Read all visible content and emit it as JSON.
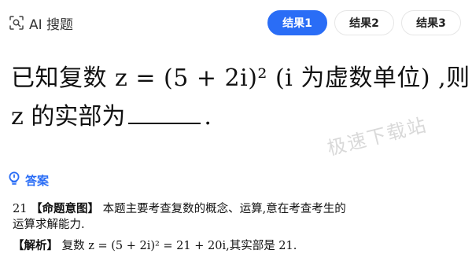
{
  "header": {
    "brand_label": "AI 搜题",
    "tabs": [
      {
        "label": "结果1",
        "active": true
      },
      {
        "label": "结果2",
        "active": false
      },
      {
        "label": "结果3",
        "active": false
      }
    ]
  },
  "question": {
    "line1": "已知复数 z = (5 + 2i)² (i 为虚数单位) ,则",
    "line2_prefix": "z 的实部为",
    "line2_suffix": "."
  },
  "watermark": "极速下载站",
  "answer": {
    "title": "答案",
    "row1_number": "21",
    "row1_bracket": "【命题意图】",
    "row1_text": "本题主要考查复数的概念、运算,意在考查考生的",
    "row2_text": "运算求解能力.",
    "row3_bracket": "【解析】",
    "row3_text": "复数 z = (5 + 2i)² = 21 + 20i,其实部是 21."
  },
  "colors": {
    "accent": "#2a6df6",
    "text": "#111111",
    "watermark": "#d9d9d9"
  }
}
